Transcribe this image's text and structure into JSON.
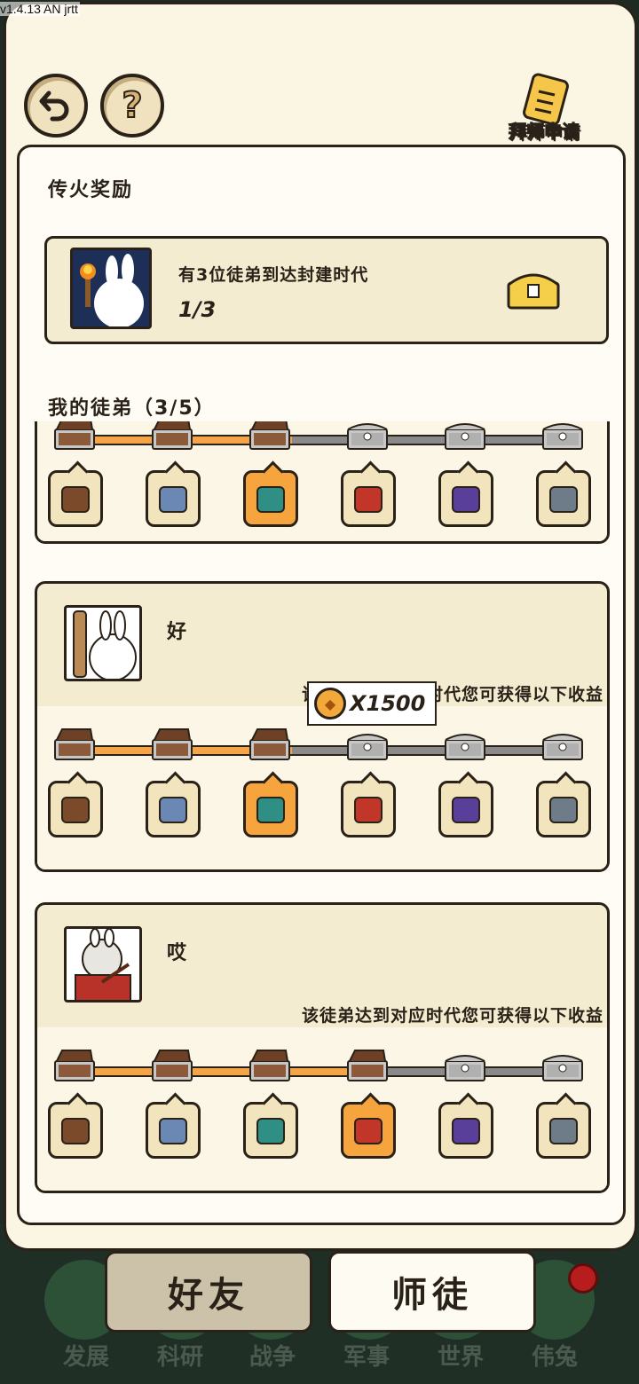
{
  "version": "v1.4.13 AN jrtt",
  "header": {
    "back_icon": "back-arrow-icon",
    "help_label": "?",
    "apply_label": "拜师申请"
  },
  "reward": {
    "section_title": "传火奖励",
    "text": "有3位徒弟到达封建时代",
    "progress": "1/3"
  },
  "disciples_title": "我的徒弟（3/5）",
  "eras": [
    "primitive-era-icon",
    "stone-era-icon",
    "bronze-era-icon",
    "feudal-era-icon",
    "industrial-era-icon",
    "modern-era-icon"
  ],
  "disciples": [
    {
      "name": "",
      "hint": "",
      "progress_index": 2
    },
    {
      "name": "好",
      "hint": "该徒弟达到对应时代您可获得以下收益",
      "progress_index": 2
    },
    {
      "name": "哎",
      "hint": "该徒弟达到对应时代您可获得以下收益",
      "progress_index": 3
    }
  ],
  "tooltip": {
    "coin_icon": "coin-icon",
    "amount": "X1500"
  },
  "tabs": {
    "friends": "好友",
    "mentor": "师徒"
  },
  "game_nav": [
    "发展",
    "科研",
    "战争",
    "军事",
    "世界",
    "伟兔"
  ],
  "colors": {
    "accent": "#f6a43e",
    "panel": "#fbf5e3",
    "track_fill": "#f5a548",
    "badge": "#b81d1d"
  }
}
